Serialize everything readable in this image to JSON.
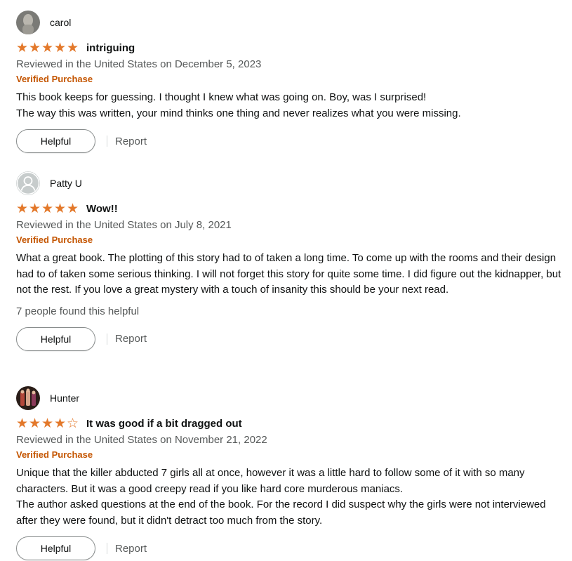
{
  "reviews": [
    {
      "name": "carol",
      "avatar": "user-photo-avatar",
      "rating": 5,
      "stars": [
        "★",
        "★",
        "★",
        "★",
        "★"
      ],
      "title": "intriguing",
      "date": "Reviewed in the United States on December 5, 2023",
      "verified": "Verified Purchase",
      "body": [
        "This book keeps for guessing. I thought I knew what was going on. Boy, was I surprised!",
        "The way this was written, your mind thinks one thing and never realizes what you were missing."
      ],
      "helpful_label": "Helpful",
      "report_label": "Report"
    },
    {
      "name": "Patty U",
      "avatar": "default-user-avatar",
      "rating": 5,
      "stars": [
        "★",
        "★",
        "★",
        "★",
        "★"
      ],
      "title": "Wow!!",
      "date": "Reviewed in the United States on July 8, 2021",
      "verified": "Verified Purchase",
      "body": [
        "What a great book. The plotting of this story had to of taken a long time. To come up with the rooms and their design had to of taken some serious thinking. I will not forget this story for quite some time. I did figure out the kidnapper, but not the rest. If you love a great mystery with a touch of insanity this should be your next read."
      ],
      "helpful_count": "7 people found this helpful",
      "helpful_label": "Helpful",
      "report_label": "Report"
    },
    {
      "name": "Hunter",
      "avatar": "user-photo-avatar",
      "rating": 4,
      "stars": [
        "★",
        "★",
        "★",
        "★",
        "☆"
      ],
      "title": "It was good if a bit dragged out",
      "date": "Reviewed in the United States on November 21, 2022",
      "verified": "Verified Purchase",
      "body": [
        "Unique that the killer abducted 7 girls all at once, however it was a little hard to follow some of it with so many characters. But it was a good creepy read if you like hard core murderous maniacs.",
        "The author asked questions at the end of the book. For the record I did suspect why the girls were not interviewed after they were found, but it didn't detract too much from the story."
      ],
      "helpful_label": "Helpful",
      "report_label": "Report"
    }
  ],
  "colors": {
    "star": "#e3782a",
    "verified": "#c45500",
    "muted_text": "#565959",
    "text": "#0f1111"
  }
}
